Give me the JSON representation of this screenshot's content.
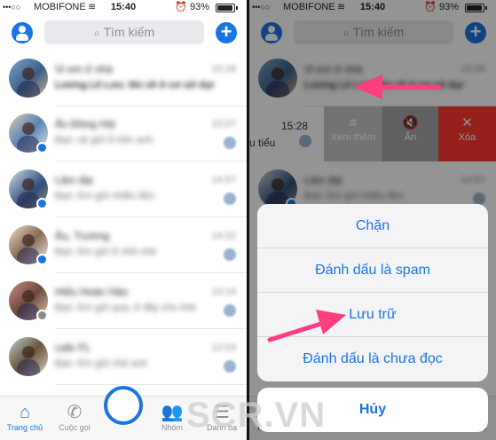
{
  "status": {
    "signal": "•••○○",
    "carrier": "MOBIFONE",
    "time": "15:40",
    "battery_pct": "93%",
    "battery_level": 0.93
  },
  "search": {
    "placeholder": "Tìm kiếm"
  },
  "icons": {
    "search": "search-icon",
    "compose": "compose-plus-icon",
    "profile": "profile-icon"
  },
  "colors": {
    "accent": "#1b74e4",
    "delete": "#ff3b30"
  },
  "conversations": [
    {
      "name": "Vi em ở nhà",
      "preview": "Lương Lê Lưu: lên về ở cơ sở dụng...",
      "date": "15:28"
    },
    {
      "name": "Ân Đông Hội",
      "preview": "Bạn: ok gửi ở trên anh.",
      "date": "15:07"
    },
    {
      "name": "Lâm đại",
      "preview": "Bạn: Em gửi nhiều lắm",
      "date": "14:57"
    },
    {
      "name": "Âu, Trường",
      "preview": "Bạn: Em gửi ở nhé nhé",
      "date": "14:22"
    },
    {
      "name": "Hiếu Hoàn Hảo",
      "preview": "Bạn: Em gửi qua, ở đây cho nhé",
      "date": "13:14"
    },
    {
      "name": "cafe FL",
      "preview": "Bạn: Em gửi nhé anh",
      "date": "12:03"
    }
  ],
  "tabs": [
    {
      "label": "Trang chủ",
      "glyph": "⌂"
    },
    {
      "label": "Cuộc gọi",
      "glyph": "✆"
    },
    {
      "label": "Nhóm",
      "glyph": "👥"
    },
    {
      "label": "Danh bạ",
      "glyph": "☰"
    }
  ],
  "swiped_row": {
    "time": "15:28",
    "snippet": "u tiểu"
  },
  "swipe_actions": {
    "more": "Xem thêm",
    "mute": "Ẩn",
    "delete": "Xóa"
  },
  "action_sheet": {
    "items": [
      "Chặn",
      "Đánh dấu là spam",
      "Lưu trữ",
      "Đánh dấu là chưa đọc"
    ],
    "cancel": "Hủy"
  },
  "watermark": "SCR.VN"
}
